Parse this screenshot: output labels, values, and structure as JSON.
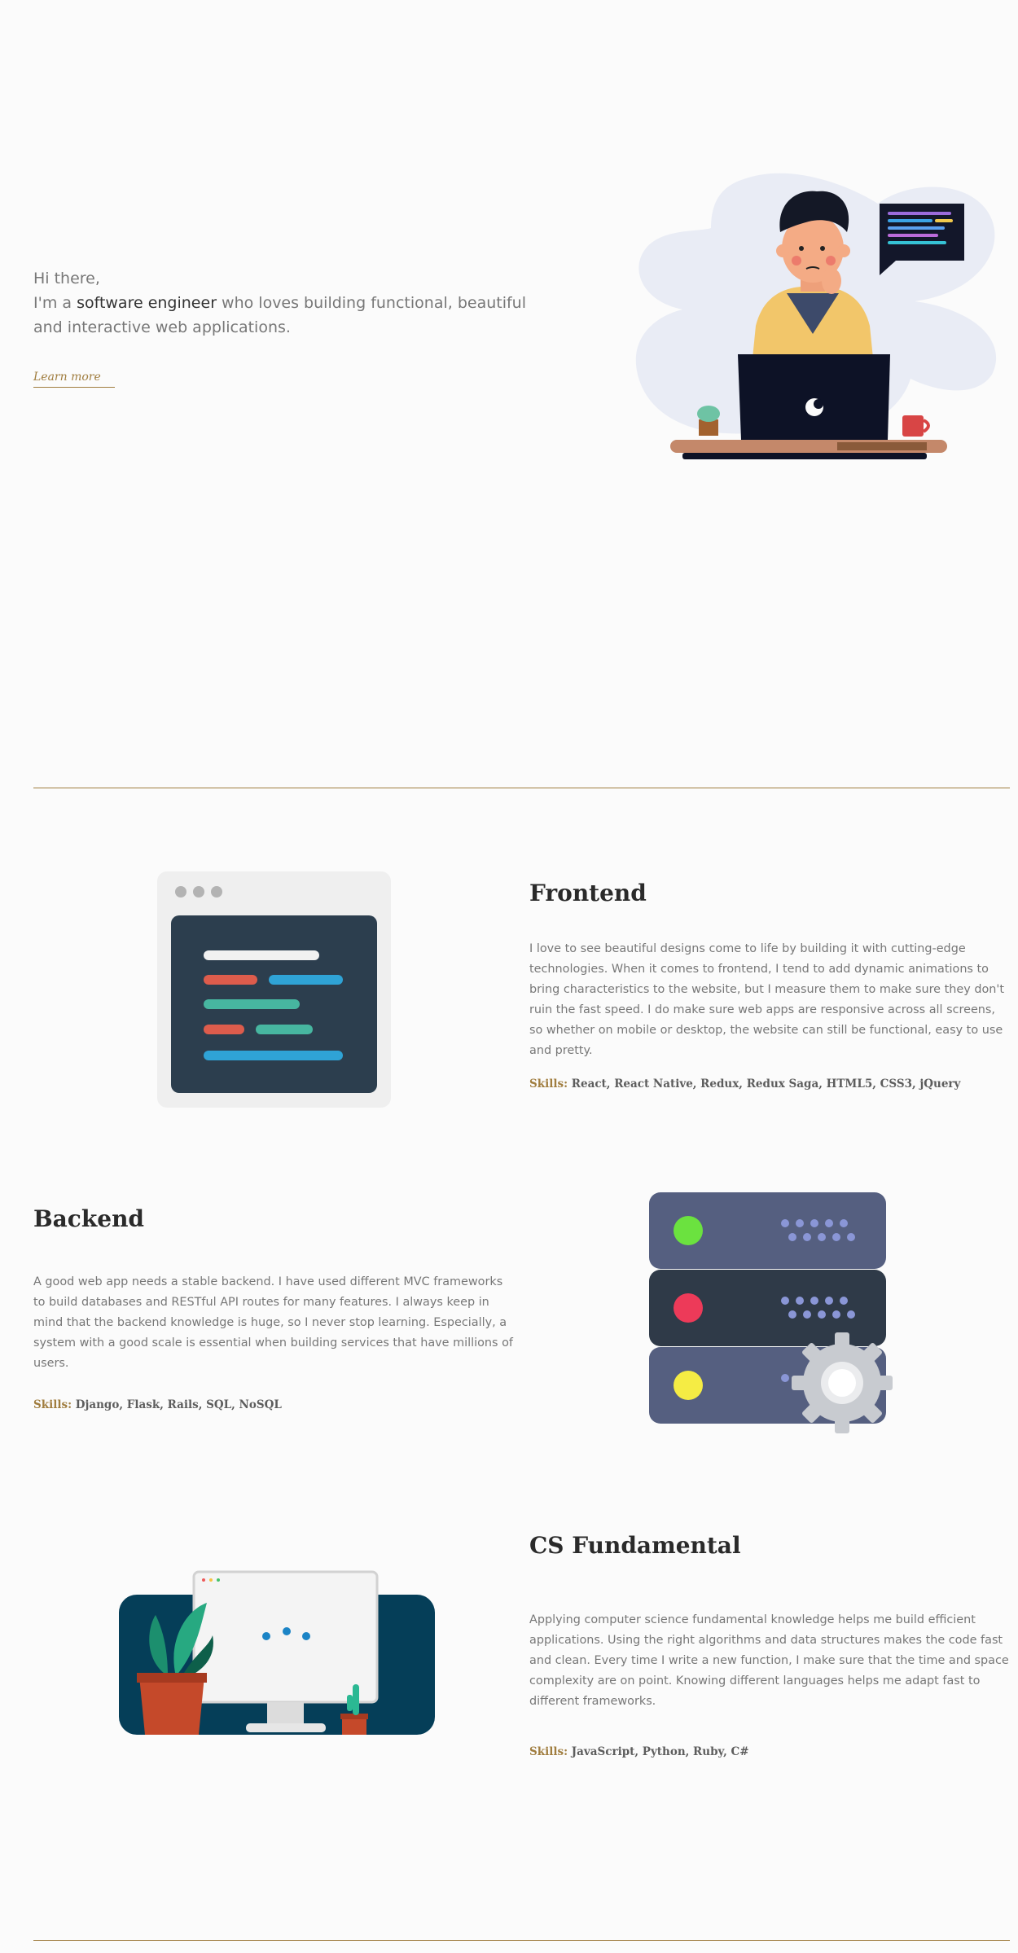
{
  "hero": {
    "greeting": "Hi there,",
    "intro_prefix": "I'm a ",
    "intro_role": "software engineer",
    "intro_suffix": " who loves building functional, beautiful and interactive web applications.",
    "learn_more": "Learn more"
  },
  "sections": {
    "frontend": {
      "title": "Frontend",
      "body": "I love to see beautiful designs come to life by building it with cutting-edge technologies. When it comes to frontend, I tend to add dynamic animations to bring characteristics to the website, but I measure them to make sure they don't ruin the fast speed. I do make sure web apps are responsive across all screens, so whether on mobile or desktop, the website can still be functional, easy to use and pretty.",
      "skills_label": "Skills:",
      "skills": " React, React Native, Redux, Redux Saga, HTML5, CSS3, jQuery"
    },
    "backend": {
      "title": "Backend",
      "body": "A good web app needs a stable backend. I have used different MVC frameworks to build databases and RESTful API routes for many features. I always keep in mind that the backend knowledge is huge, so I never stop learning. Especially, a system with a good scale is essential when building services that have millions of users.",
      "skills_label": "Skills:",
      "skills": " Django, Flask, Rails, SQL, NoSQL"
    },
    "cs": {
      "title": "CS Fundamental",
      "body": "Applying computer science fundamental knowledge helps me build efficient applications. Using the right algorithms and data structures makes the code fast and clean. Every time I write a new function, I make sure that the time and space complexity are on point. Knowing different languages helps me adapt fast to different frameworks.",
      "skills_label": "Skills:",
      "skills": " JavaScript, Python, Ruby, C#"
    }
  },
  "colors": {
    "accent": "#a07d3f",
    "background": "#fbfbfb"
  },
  "icons": {
    "hero": "developer-at-laptop-illustration",
    "frontend": "code-editor-window-illustration",
    "backend": "server-stack-with-gear-illustration",
    "cs": "monitor-with-plants-illustration"
  }
}
